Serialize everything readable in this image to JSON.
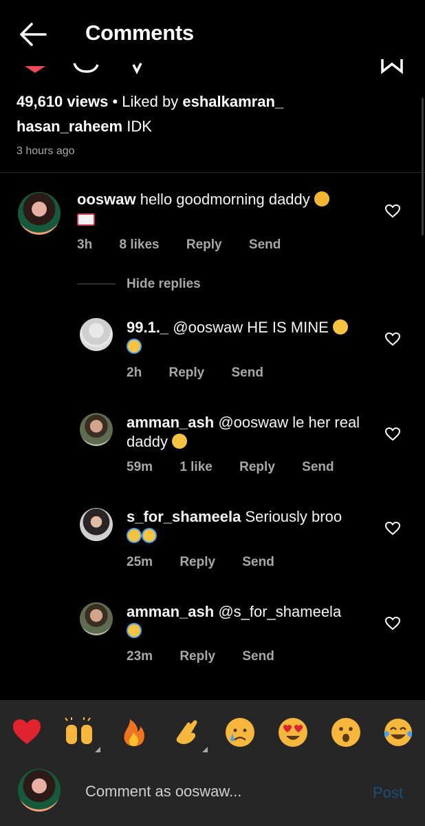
{
  "header": {
    "title": "Comments"
  },
  "post": {
    "views": "49,610 views",
    "liked_prefix": "Liked by",
    "liked_user": "eshalkamran_",
    "caption_user": "hasan_raheem",
    "caption_text": "IDK",
    "time_ago": "3 hours ago"
  },
  "comments": [
    {
      "user": "ooswaw",
      "text": "hello goodmorning daddy",
      "time": "3h",
      "likes": "8 likes",
      "reply": "Reply",
      "send": "Send"
    }
  ],
  "hide_replies": "Hide replies",
  "replies": [
    {
      "user": "99.1._",
      "text": "@ooswaw HE IS MINE",
      "time": "2h",
      "reply": "Reply",
      "send": "Send"
    },
    {
      "user": "amman_ash",
      "text": "@ooswaw le her real daddy",
      "time": "59m",
      "likes": "1 like",
      "reply": "Reply",
      "send": "Send"
    },
    {
      "user": "s_for_shameela",
      "text": "Seriously broo",
      "time": "25m",
      "reply": "Reply",
      "send": "Send"
    },
    {
      "user": "amman_ash",
      "text": "@s_for_shameela",
      "time": "23m",
      "reply": "Reply",
      "send": "Send"
    }
  ],
  "emoji_bar": [
    "heart",
    "raising-hands",
    "fire",
    "clapping-hands",
    "crying-face",
    "heart-eyes",
    "surprised-face",
    "tears-of-joy"
  ],
  "composer": {
    "placeholder": "Comment as ooswaw...",
    "post_label": "Post"
  },
  "colors": {
    "background": "#000000",
    "panel": "#262626",
    "muted": "#a8a8a8",
    "post_disabled": "#1b4f7a",
    "heart_red": "#ed4956"
  }
}
